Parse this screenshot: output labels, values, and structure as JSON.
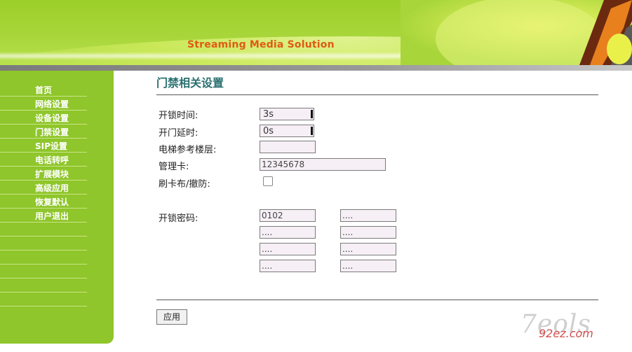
{
  "header": {
    "brand": "Streaming Media Solution"
  },
  "sidebar": {
    "items": [
      {
        "label": "首页"
      },
      {
        "label": "网络设置"
      },
      {
        "label": "设备设置"
      },
      {
        "label": "门禁设置"
      },
      {
        "label": "SIP设置"
      },
      {
        "label": "电话转呼"
      },
      {
        "label": "扩展模块"
      },
      {
        "label": "高级应用"
      },
      {
        "label": "恢复默认"
      },
      {
        "label": "用户退出"
      }
    ]
  },
  "main": {
    "title": "门禁相关设置",
    "unlock_time_label": "开锁时间:",
    "unlock_time_value": "3s",
    "door_delay_label": "开门延时:",
    "door_delay_value": "0s",
    "elevator_floor_label": "电梯参考楼层:",
    "elevator_floor_value": "",
    "admin_card_label": "管理卡:",
    "admin_card_value": "12345678",
    "arm_label": "刷卡布/撤防:",
    "arm_checked": false,
    "password_label": "开锁密码:",
    "passwords": [
      "0102",
      "....",
      "....",
      "....",
      "....",
      "....",
      "....",
      "...."
    ],
    "apply_label": "应用"
  },
  "watermark": {
    "line1": "7eols",
    "line2": "92ez.com"
  }
}
